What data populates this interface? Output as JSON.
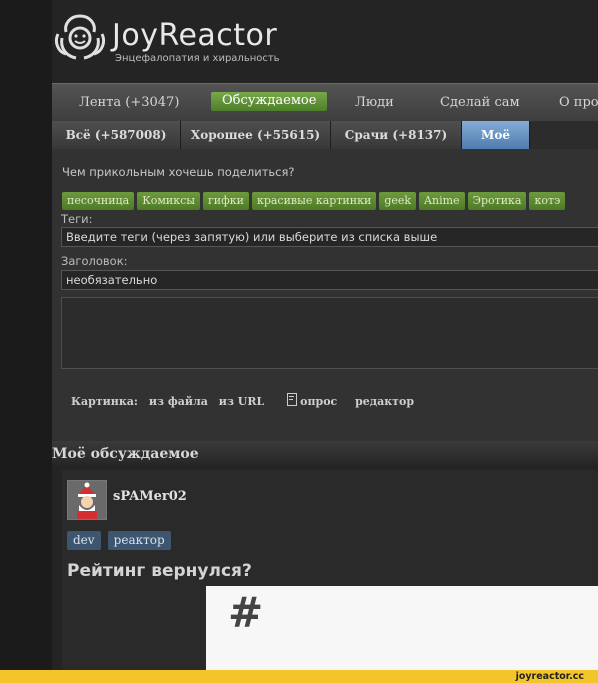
{
  "header": {
    "title": "JoyReactor",
    "subtitle": "Энцефалопатия и хиральность"
  },
  "main_nav": [
    {
      "label": "Лента (+3047)",
      "active": false
    },
    {
      "label": "Обсуждаемое",
      "active": true
    },
    {
      "label": "Люди",
      "active": false
    },
    {
      "label": "Сделай сам",
      "active": false
    },
    {
      "label": "О прос",
      "active": false
    }
  ],
  "sub_nav": [
    {
      "label": "Всё (+587008)",
      "active": false
    },
    {
      "label": "Хорошее (+55615)",
      "active": false
    },
    {
      "label": "Срачи (+8137)",
      "active": false
    },
    {
      "label": "Моё",
      "active": true
    }
  ],
  "form": {
    "prompt": "Чем прикольным хочешь поделиться?",
    "quick_tags": [
      "песочница",
      "Комиксы",
      "гифки",
      "красивые картинки",
      "geek",
      "Anime",
      "Эротика",
      "котэ"
    ],
    "tags_label": "Теги:",
    "tags_placeholder": "Введите теги (через запятую) или выберите из списка выше",
    "title_label": "Заголовок:",
    "title_placeholder": "необязательно",
    "tools": {
      "picture_label": "Картинка:",
      "from_file": "из файла",
      "from_url": "из URL",
      "poll": "опрос",
      "editor": "редактор"
    }
  },
  "section": {
    "title": "Моё обсуждаемое"
  },
  "post": {
    "author": "sPAMer02",
    "tags": [
      "dev",
      "реактор"
    ],
    "title": "Рейтинг вернулся?",
    "image_glyph": "#"
  },
  "footer": {
    "watermark": "joyreactor.cc"
  },
  "colors": {
    "accent_green": "#5e8c33",
    "accent_blue": "#5e8ac0",
    "tag_blue": "#3e5570",
    "footer_yellow": "#f3c52a"
  }
}
